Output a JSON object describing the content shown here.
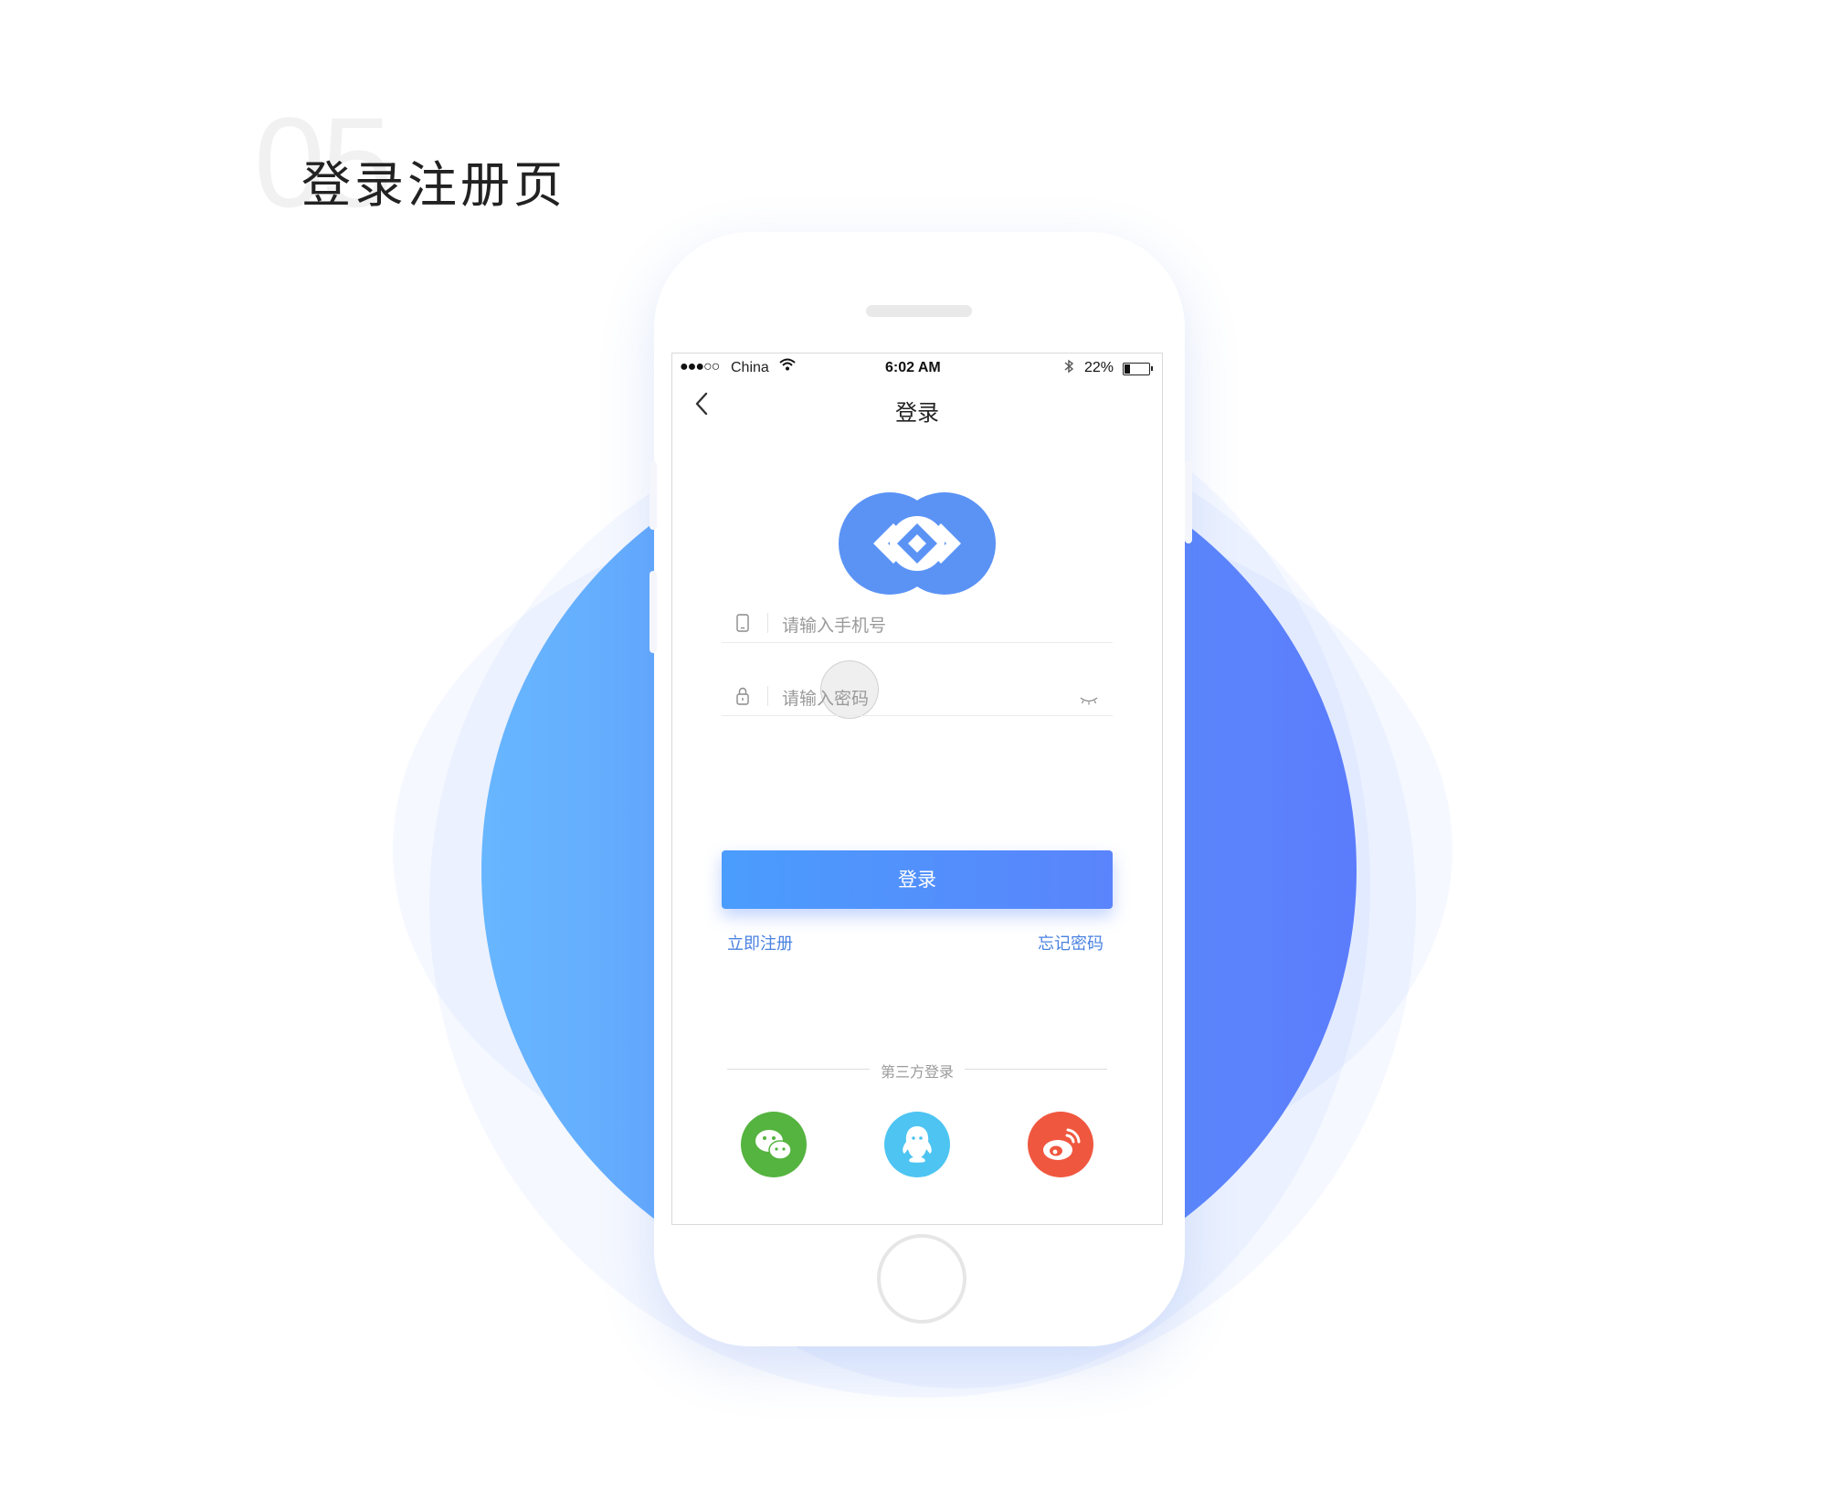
{
  "header": {
    "section_number": "05",
    "section_title": "登录注册页"
  },
  "status_bar": {
    "signal": "●●●○○",
    "carrier": "China",
    "time": "6:02 AM",
    "battery_pct": "22%",
    "battery_level": 0.22
  },
  "nav": {
    "back_icon": "chevron-left-icon",
    "title": "登录"
  },
  "form": {
    "phone_placeholder": "请输入手机号",
    "password_placeholder": "请输入密码",
    "phone_icon": "phone-icon",
    "password_icon": "lock-icon",
    "eye_icon": "eye-closed-icon"
  },
  "actions": {
    "login_label": "登录",
    "register_label": "立即注册",
    "forgot_label": "忘记密码"
  },
  "third_party": {
    "label": "第三方登录",
    "providers": [
      {
        "icon": "wechat-icon",
        "color": "#55b33f"
      },
      {
        "icon": "qq-icon",
        "color": "#4dc4f2"
      },
      {
        "icon": "weibo-icon",
        "color": "#f0573f"
      }
    ]
  },
  "colors": {
    "accent": "#5a8cfb",
    "link": "#4a82e0",
    "logo": "#5b93f5"
  }
}
